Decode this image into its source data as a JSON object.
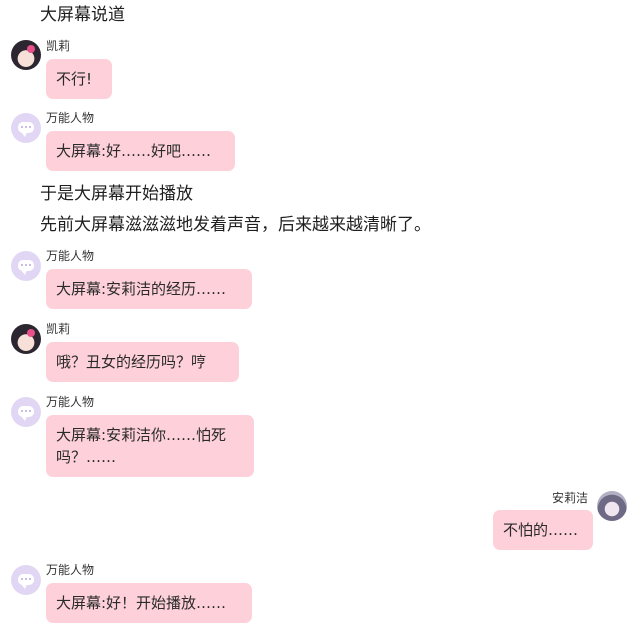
{
  "narration": {
    "line1": "大屏幕说道",
    "line2": "于是大屏幕开始播放",
    "line3": "先前大屏幕滋滋滋地发着声音，后来越来越清晰了。"
  },
  "messages": [
    {
      "speaker": "凯莉",
      "text": "不行!"
    },
    {
      "speaker": "万能人物",
      "text": "大屏幕:好……好吧……"
    },
    {
      "speaker": "万能人物",
      "text": "大屏幕:安莉洁的经历……"
    },
    {
      "speaker": "凯莉",
      "text": "哦？丑女的经历吗？哼"
    },
    {
      "speaker": "万能人物",
      "text": "大屏幕:安莉洁你……怕死吗？……"
    },
    {
      "speaker": "安莉洁",
      "text": "不怕的……"
    },
    {
      "speaker": "万能人物",
      "text": "大屏幕:好！开始播放……"
    }
  ],
  "colors": {
    "bubble": "#fdd0da",
    "bot_avatar": "#e1d7f4"
  }
}
